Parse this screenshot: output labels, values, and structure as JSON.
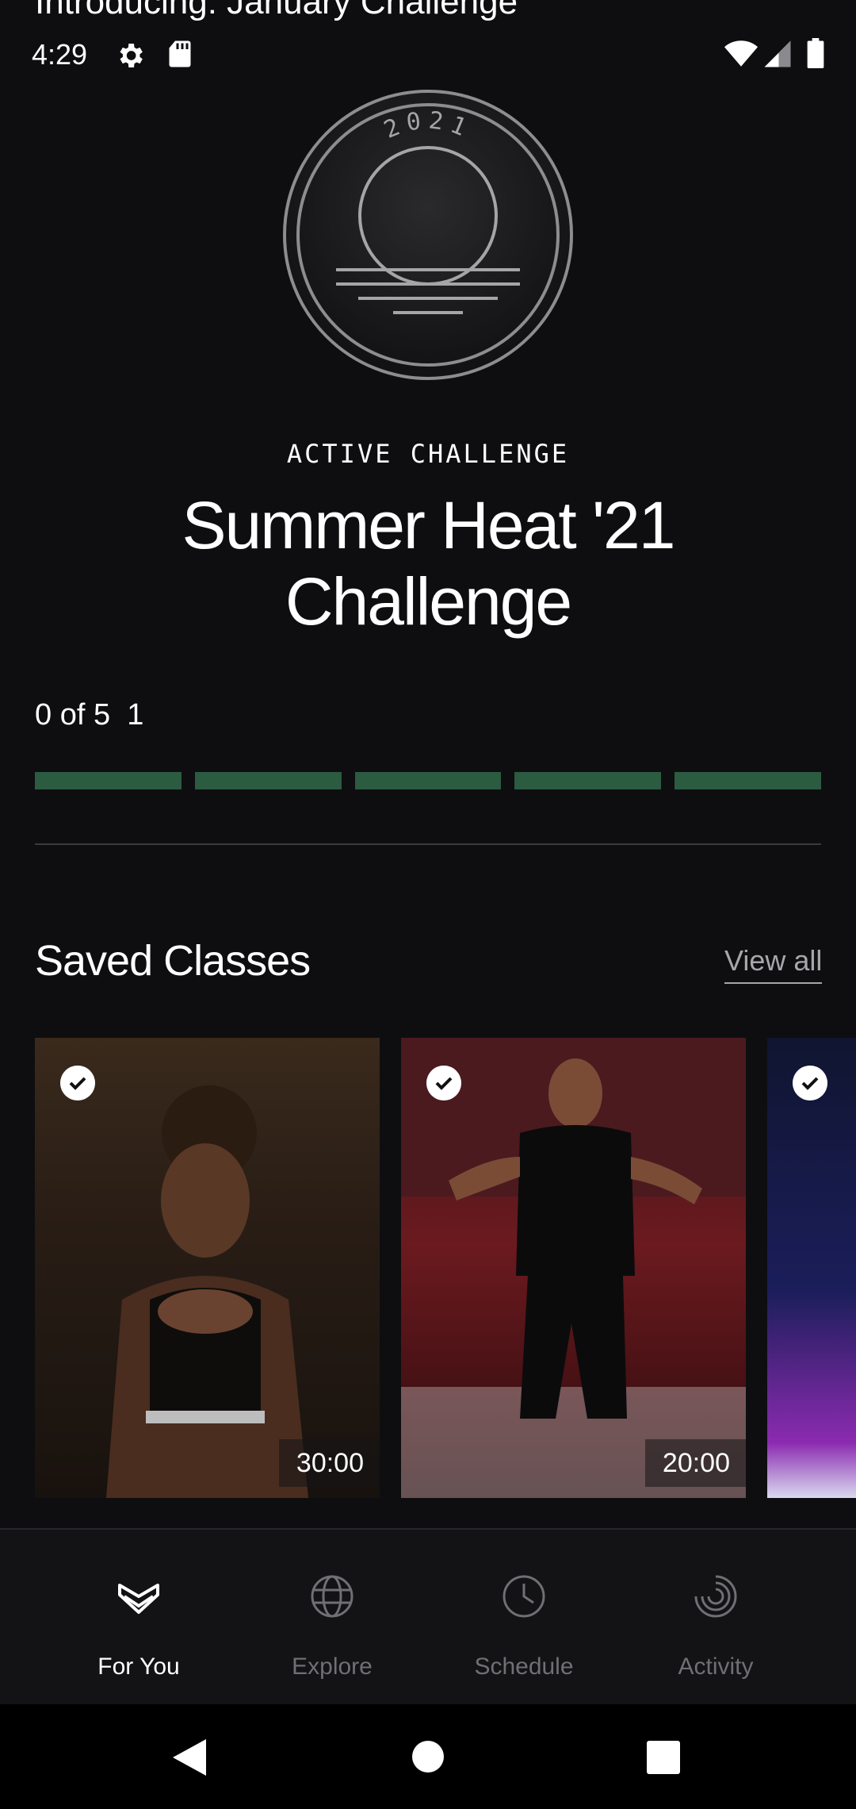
{
  "banner": {
    "intro_text": "Introducing: January Challenge"
  },
  "status_bar": {
    "time": "4:29",
    "icons": [
      "gear-icon",
      "sd-card-icon",
      "wifi-icon",
      "cell-signal-icon",
      "battery-icon"
    ]
  },
  "badge": {
    "year": "2021"
  },
  "challenge": {
    "kicker": "ACTIVE CHALLENGE",
    "title_line1": "Summer Heat '21",
    "title_line2": "Challenge",
    "progress_text": "0 of 5  1",
    "completed": 0,
    "total": 5,
    "bar_color": "#2b5b40"
  },
  "saved_classes": {
    "title": "Saved Classes",
    "view_all": "View all",
    "cards": [
      {
        "duration": "30:00",
        "saved": true
      },
      {
        "duration": "20:00",
        "saved": true
      },
      {
        "duration": "",
        "saved": true
      }
    ]
  },
  "bottom_nav": {
    "items": [
      {
        "label": "For You",
        "icon": "heart-chevron-icon",
        "active": true
      },
      {
        "label": "Explore",
        "icon": "globe-icon",
        "active": false
      },
      {
        "label": "Schedule",
        "icon": "clock-icon",
        "active": false
      },
      {
        "label": "Activity",
        "icon": "activity-rings-icon",
        "active": false
      }
    ]
  },
  "system_nav": {
    "icons": [
      "back-icon",
      "home-icon",
      "recents-icon"
    ]
  },
  "colors": {
    "background": "#0e0e10",
    "nav_background": "#131315",
    "active": "#ffffff",
    "inactive": "#6f6f74"
  }
}
